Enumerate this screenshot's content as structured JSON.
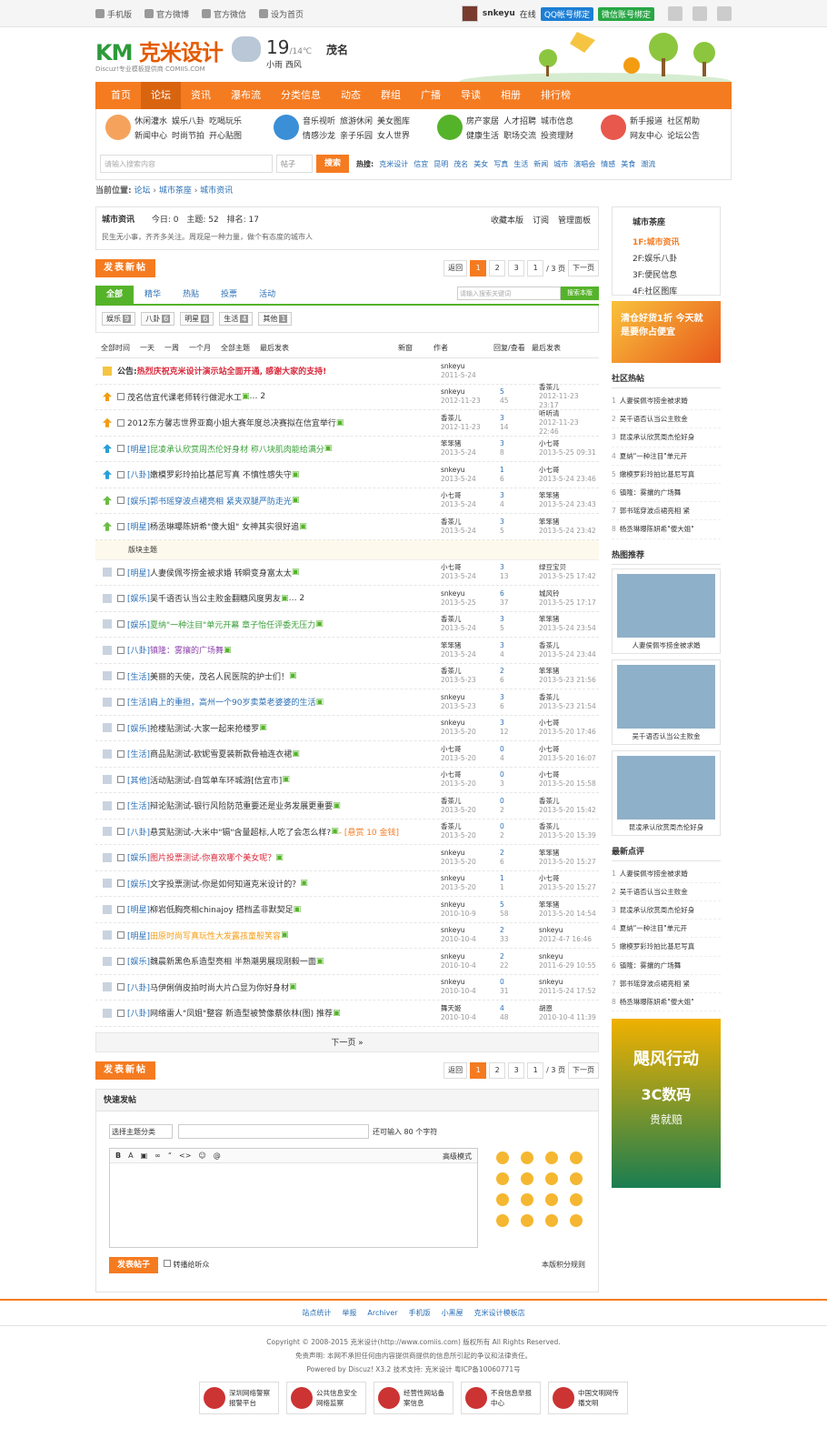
{
  "topbar": {
    "links": [
      "手机版",
      "官方微博",
      "官方微信",
      "设为首页"
    ],
    "user": "snkeyu",
    "status": "在线",
    "qq": "QQ帐号绑定",
    "wx": "微信账号绑定"
  },
  "logo": {
    "name": "克米设计",
    "sub": "Discuz!专业模板提供商 COMIIS.COM"
  },
  "weather": {
    "temp": "19",
    "range": "/14℃",
    "desc": "小雨 西风",
    "city": "茂名"
  },
  "nav": [
    "首页",
    "论坛",
    "资讯",
    "瀑布流",
    "分类信息",
    "动态",
    "群组",
    "广播",
    "导读",
    "相册",
    "排行榜"
  ],
  "subnav": {
    "g1": [
      "休闲灌水",
      "娱乐八卦",
      "吃喝玩乐",
      "新闻中心",
      "时尚节拍",
      "开心贴图"
    ],
    "g2": [
      "音乐视听",
      "旅游休闲",
      "美女图库",
      "情感沙龙",
      "亲子乐园",
      "女人世界"
    ],
    "g3": [
      "房产家居",
      "人才招聘",
      "城市信息",
      "健康生活",
      "职场交流",
      "投资理财"
    ],
    "g4": [
      "新手报道",
      "社区帮助",
      "网友中心",
      "论坛公告"
    ]
  },
  "search": {
    "placeholder": "请输入搜索内容",
    "type": "帖子",
    "btn": "搜索",
    "hot_label": "热搜:",
    "hot": [
      "克米设计",
      "信宜",
      "昆明",
      "茂名",
      "美女",
      "写真",
      "生活",
      "新闻",
      "城市",
      "演唱会",
      "情感",
      "美食",
      "潮流"
    ]
  },
  "crumb": {
    "label": "当前位置:",
    "items": [
      "论坛",
      "城市茶座",
      "城市资讯"
    ]
  },
  "forum": {
    "name": "城市资讯",
    "today": "今日: 0",
    "topics": "主题: 52",
    "rank": "排名: 17",
    "fav": "收藏本版",
    "sub": "订阅",
    "admin": "管理面板",
    "desc": "民生无小事，齐齐多关注。周观是一种力量，做个有态度的城市人"
  },
  "post_btn": "发表新帖",
  "pager": {
    "back": "返回",
    "pages": [
      "1",
      "2",
      "3"
    ],
    "input": "1",
    "total": "/ 3 页",
    "next": "下一页"
  },
  "tabs": [
    "全部",
    "精华",
    "热贴",
    "投票",
    "活动"
  ],
  "tsearch": {
    "placeholder": "请输入搜索关键词",
    "btn": "搜索本版"
  },
  "types": [
    {
      "n": "娱乐",
      "c": "9"
    },
    {
      "n": "八卦",
      "c": "6"
    },
    {
      "n": "明星",
      "c": "6"
    },
    {
      "n": "生活",
      "c": "4"
    },
    {
      "n": "其他",
      "c": "1"
    }
  ],
  "filter": {
    "items": [
      "全部时间",
      "一天",
      "一周",
      "一个月",
      "全部主题",
      "最后发表"
    ],
    "new": "新窗",
    "author": "作者",
    "reply": "回复/查看",
    "last": "最后发表"
  },
  "announce": {
    "label": "公告:",
    "text": "热烈庆祝克米设计演示站全面开通, 感谢大家的支持!",
    "author": "snkeyu",
    "date": "2011-5-24"
  },
  "top_threads": [
    {
      "t": "茂名信宜代课老师转行做泥水工",
      "x": "… 2",
      "a": "snkeyu",
      "d": "2012-11-23",
      "r": "5",
      "v": "45",
      "l": "香茶儿",
      "ld": "2012-11-23 23:17",
      "c": "#f39c12"
    },
    {
      "t": "2012东方馨志世界亚裔小姐大赛年度总决赛拟在信宜举行",
      "x": "",
      "a": "香茶儿",
      "d": "2012-11-23",
      "r": "3",
      "v": "14",
      "l": "听听清",
      "ld": "2012-11-23 22:46",
      "c": "#f39c12"
    },
    {
      "ty": "[明星]",
      "t": "昆凌承认欣赏周杰伦好身材 称八块肌肉能给满分",
      "a": "笨笨猪",
      "d": "2013-5-24",
      "r": "3",
      "v": "8",
      "l": "小七哥",
      "ld": "2013-5-25 09:31",
      "c": "#2a9fd6",
      "tc": "#3a9f3a"
    },
    {
      "ty": "[八卦]",
      "t": "嫩模罗彩玲拍比基尼写真 不慎性感失守",
      "a": "snkeyu",
      "d": "2013-5-24",
      "r": "1",
      "v": "6",
      "l": "小七哥",
      "ld": "2013-5-24 23:46",
      "c": "#2a9fd6"
    },
    {
      "ty": "[娱乐]",
      "t": "郭书瑶穿波点裙亮相 紧夹双腿严防走光",
      "a": "小七哥",
      "d": "2013-5-24",
      "r": "3",
      "v": "4",
      "l": "笨笨猪",
      "ld": "2013-5-24 23:43",
      "c": "#6cbd45",
      "tc": "#2a6fb5"
    },
    {
      "ty": "[明星]",
      "t": "杨丞琳曝陈妍希\"傻大姐\" 女神其实很好追",
      "a": "香茶儿",
      "d": "2013-5-24",
      "r": "3",
      "v": "5",
      "l": "笨笨猪",
      "ld": "2013-5-24 23:42",
      "c": "#6cbd45"
    }
  ],
  "sep": "版块主题",
  "threads": [
    {
      "ty": "[明星]",
      "t": "人妻侯佩岑捞金被求婚 转瞬变身富太太",
      "a": "小七哥",
      "d": "2013-5-24",
      "r": "3",
      "v": "13",
      "l": "绿豆宝贝",
      "ld": "2013-5-25 17:42"
    },
    {
      "ty": "[娱乐]",
      "t": "吴千语否认当公主败金翻糖风度男友",
      "x": "… 2",
      "a": "snkeyu",
      "d": "2013-5-25",
      "r": "6",
      "v": "37",
      "l": "城风铃",
      "ld": "2013-5-25 17:17"
    },
    {
      "ty": "[娱乐]",
      "t": "夏纳\"一种注目\"单元开幕 章子怡任评委无压力",
      "a": "香茶儿",
      "d": "2013-5-24",
      "r": "3",
      "v": "5",
      "l": "笨笨猪",
      "ld": "2013-5-24 23:54",
      "tc": "#3a9f3a"
    },
    {
      "ty": "[八卦]",
      "t": "镇隆：雾攘的广场舞",
      "a": "笨笨猪",
      "d": "2013-5-24",
      "r": "3",
      "v": "4",
      "l": "香茶儿",
      "ld": "2013-5-24 23:44",
      "tc": "#8e44ad"
    },
    {
      "ty": "[生活]",
      "t": "美丽的天使，茂名人民医院的护士们！",
      "a": "香茶儿",
      "d": "2013-5-23",
      "r": "2",
      "v": "6",
      "l": "笨笨猪",
      "ld": "2013-5-23 21:56"
    },
    {
      "ty": "[生活]",
      "t": "肩上的重担，高州一个90岁卖菜老婆婆的生活",
      "a": "snkeyu",
      "d": "2013-5-23",
      "r": "3",
      "v": "6",
      "l": "香茶儿",
      "ld": "2013-5-23 21:54",
      "tc": "#2a6fb5"
    },
    {
      "ty": "[娱乐]",
      "t": "抢楼贴测试-大家一起来抢楼罗",
      "a": "snkeyu",
      "d": "2013-5-20",
      "r": "3",
      "v": "12",
      "l": "小七哥",
      "ld": "2013-5-20 17:46"
    },
    {
      "ty": "[生活]",
      "t": "商品贴测试-欧妮雪夏装新款骨袖连衣裙",
      "a": "小七哥",
      "d": "2013-5-20",
      "r": "0",
      "v": "4",
      "l": "小七哥",
      "ld": "2013-5-20 16:07"
    },
    {
      "ty": "[其他]",
      "t": "活动贴测试-自驾单车环城游[信宜市]",
      "a": "小七哥",
      "d": "2013-5-20",
      "r": "0",
      "v": "3",
      "l": "小七哥",
      "ld": "2013-5-20 15:58"
    },
    {
      "ty": "[生活]",
      "t": "辩论贴测试-银行风险防范重要还是业务发展更重要",
      "a": "香茶儿",
      "d": "2013-5-20",
      "r": "0",
      "v": "2",
      "l": "香茶儿",
      "ld": "2013-5-20 15:42"
    },
    {
      "ty": "[八卦]",
      "t": "悬赏贴测试-大米中\"镉\"含量超标,人吃了会怎么样?",
      "x": "- [悬赏 10 金钱]",
      "a": "香茶儿",
      "d": "2013-5-20",
      "r": "0",
      "v": "2",
      "l": "香茶儿",
      "ld": "2013-5-20 15:39"
    },
    {
      "ty": "[娱乐]",
      "t": "图片投票测试-你喜欢哪个美女呢？",
      "a": "snkeyu",
      "d": "2013-5-20",
      "r": "2",
      "v": "6",
      "l": "笨笨猪",
      "ld": "2013-5-20 15:27",
      "tc": "#d9283b"
    },
    {
      "ty": "[娱乐]",
      "t": "文字投票测试-你是如何知道克米设计的？",
      "a": "snkeyu",
      "d": "2013-5-20",
      "r": "1",
      "v": "1",
      "l": "小七哥",
      "ld": "2013-5-20 15:27"
    },
    {
      "ty": "[明星]",
      "t": "柳岩低胸亮相chinajoy 搭档孟非默契足",
      "a": "snkeyu",
      "d": "2010-10-9",
      "r": "5",
      "v": "58",
      "l": "笨笨猪",
      "ld": "2013-5-20 14:54"
    },
    {
      "ty": "[明星]",
      "t": "田原时尚写真玩性大发露孩童般笑容",
      "a": "snkeyu",
      "d": "2010-10-4",
      "r": "2",
      "v": "33",
      "l": "snkeyu",
      "ld": "2012-4-7 16:46",
      "tc": "#f39c12"
    },
    {
      "ty": "[娱乐]",
      "t": "魏晨新黑色系造型亮相 半熟潮男展现刚毅一面",
      "a": "snkeyu",
      "d": "2010-10-4",
      "r": "2",
      "v": "22",
      "l": "snkeyu",
      "ld": "2011-6-29 10:55"
    },
    {
      "ty": "[八卦]",
      "t": "马伊俐俏皮拍时尚大片凸显为你好身材",
      "a": "snkeyu",
      "d": "2010-10-4",
      "r": "0",
      "v": "31",
      "l": "snkeyu",
      "ld": "2011-5-24 17:52"
    },
    {
      "ty": "[八卦]",
      "t": "网络雷人\"凤姐\"整容 新造型被赞像蔡依林(图) 推荐",
      "a": "舞天姬",
      "d": "2010-10-4",
      "r": "4",
      "v": "48",
      "l": "胡恩",
      "ld": "2010-10-4 11:39"
    }
  ],
  "next_page": "下一页 »",
  "quick": {
    "title": "快速发帖",
    "type": "选择主题分类",
    "count": "还可输入 80 个字符",
    "adv": "高级模式",
    "post": "发表帖子",
    "sync": "转播给听众",
    "rule": "本版积分规则"
  },
  "side": {
    "cat_title": "城市茶座",
    "cat_items": [
      "1F:城市资讯",
      "2F:娱乐八卦",
      "3F:便民信息",
      "4F:社区图库"
    ],
    "banner": "清仓好货1折 今天就是要你占便宜",
    "hot_title": "社区热帖",
    "hot": [
      "人妻侯佩岑捞金被求婚",
      "吴千语否认当公主败金",
      "昆凌承认欣赏周杰伦好身",
      "夏纳\"一种注目\"单元开",
      "嫩模罗彩玲拍比基尼写真",
      "镇隆：雾攘的广场舞",
      "郭书瑶穿波点裙亮相 紧",
      "杨丞琳曝陈妍希\"傻大姐\""
    ],
    "pic_title": "热图推荐",
    "pics": [
      "人妻侯佩岑捞金被求婚",
      "吴千语否认当公主败金",
      "昆凌承认欣赏周杰伦好身"
    ],
    "new_title": "最新点评",
    "new": [
      "人妻侯佩岑捞金被求婚",
      "吴千语否认当公主败金",
      "昆凌承认欣赏周杰伦好身",
      "夏纳\"一种注目\"单元开",
      "嫩模罗彩玲拍比基尼写真",
      "镇隆：雾攘的广场舞",
      "郭书瑶穿波点裙亮相 紧",
      "杨丞琳曝陈妍希\"傻大姐\""
    ],
    "ad": {
      "a1": "飓风行动",
      "a2": "3C数码",
      "a3": "贵就赔"
    }
  },
  "footer": {
    "links": [
      "站点统计",
      "举报",
      "Archiver",
      "手机版",
      "小黑屋",
      "克米设计模板店"
    ],
    "copy": "Copyright © 2008-2015 克米设计(http://www.comiis.com) 版权所有 All Rights Reserved.",
    "disclaim": "免责声明: 本网不承担任何由内容提供商提供的信息所引起的争议和法律责任。",
    "powered": "Powered by Discuz! X3.2  技术支持: 克米设计  粤ICP备10060771号",
    "badges": [
      "深圳网络警察报警平台",
      "公共信息安全网络监察",
      "经营性网站备案信息",
      "不良信息举报中心",
      "中国文明网传播文明"
    ]
  }
}
